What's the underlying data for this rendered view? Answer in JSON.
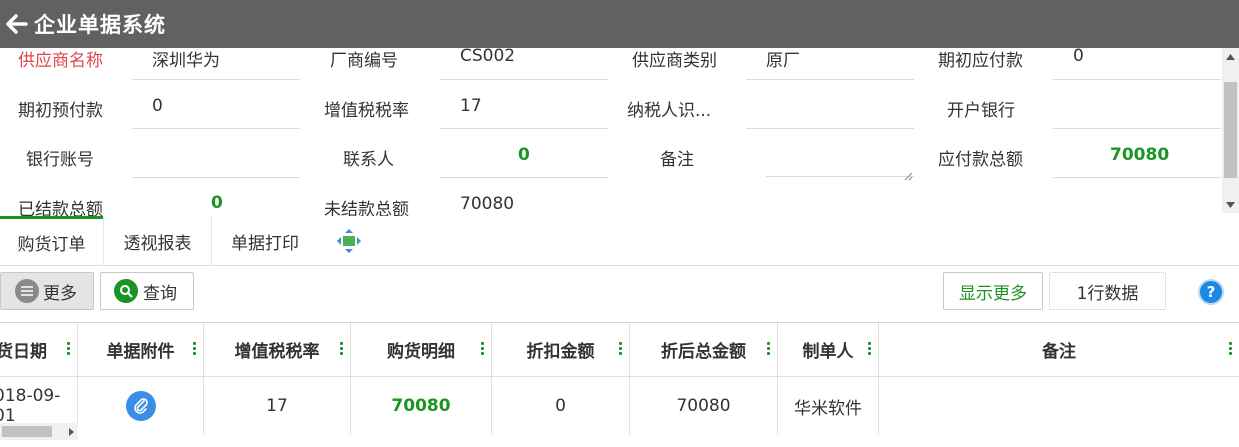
{
  "app": {
    "title": "企业单据系统"
  },
  "form": {
    "row1": {
      "supplier_name_label": "供应商名称",
      "supplier_name_value": "深圳华为",
      "vendor_code_label": "厂商编号",
      "vendor_code_value": "CS002",
      "supplier_type_label": "供应商类别",
      "supplier_type_value": "原厂",
      "opening_payable_label": "期初应付款",
      "opening_payable_value": "0"
    },
    "row2": {
      "opening_prepay_label": "期初预付款",
      "opening_prepay_value": "0",
      "vat_rate_label": "增值税税率",
      "vat_rate_value": "17",
      "taxpayer_id_label": "纳税人识...",
      "taxpayer_id_value": "",
      "bank_label": "开户银行",
      "bank_value": ""
    },
    "row3": {
      "bank_account_label": "银行账号",
      "bank_account_value": "",
      "contact_label": "联系人",
      "contact_value": "0",
      "remark_label": "备注",
      "remark_value": "",
      "payable_total_label": "应付款总额",
      "payable_total_value": "70080"
    },
    "row4": {
      "settled_total_label": "已结款总额",
      "settled_total_value": "0",
      "unsettled_total_label": "未结款总额",
      "unsettled_total_value": "70080"
    }
  },
  "tabs": [
    {
      "label": "购货订单",
      "active": true
    },
    {
      "label": "透视报表",
      "active": false
    },
    {
      "label": "单据打印",
      "active": false
    }
  ],
  "toolbar": {
    "more_label": "更多",
    "query_label": "查询",
    "show_more_label": "显示更多",
    "row_count_label": "1行数据"
  },
  "table": {
    "columns": [
      "货日期",
      "单据附件",
      "增值税税率",
      "购货明细",
      "折扣金额",
      "折后总金额",
      "制单人",
      "备注"
    ],
    "rows": [
      {
        "date": "018-09-01",
        "vat": "17",
        "detail": "70080",
        "discount": "0",
        "total_after": "70080",
        "creator": "华米软件",
        "remark": ""
      }
    ]
  },
  "colors": {
    "titlebar": "#616161",
    "accent_green": "#1c9424",
    "required_red": "#e0474c",
    "help_blue": "#1e88e5"
  }
}
